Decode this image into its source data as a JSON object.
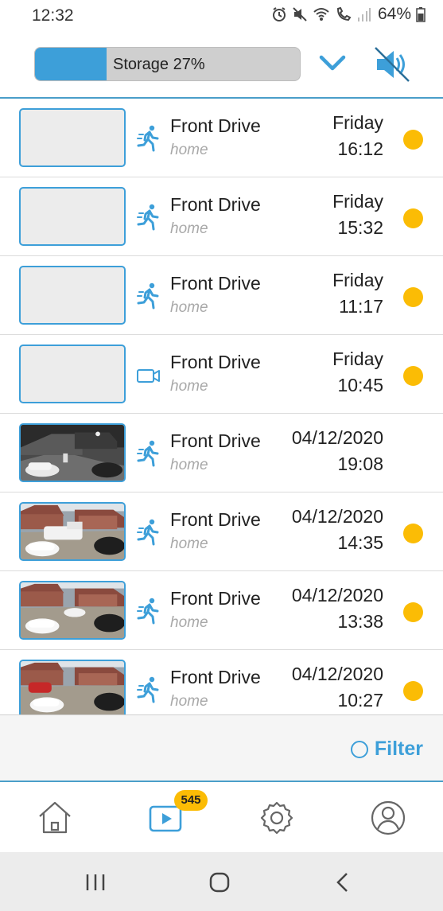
{
  "status_bar": {
    "time": "12:32",
    "battery": "64%"
  },
  "top_bar": {
    "storage_label": "Storage 27%",
    "storage_percent": 27
  },
  "events": [
    {
      "thumbnail": "blank",
      "type_icon": "motion-icon",
      "camera": "Front Drive",
      "location": "home",
      "day": "Friday",
      "time": "16:12",
      "unread": true
    },
    {
      "thumbnail": "blank",
      "type_icon": "motion-icon",
      "camera": "Front Drive",
      "location": "home",
      "day": "Friday",
      "time": "15:32",
      "unread": true
    },
    {
      "thumbnail": "blank",
      "type_icon": "motion-icon",
      "camera": "Front Drive",
      "location": "home",
      "day": "Friday",
      "time": "11:17",
      "unread": true
    },
    {
      "thumbnail": "blank",
      "type_icon": "video-camera-icon",
      "camera": "Front Drive",
      "location": "home",
      "day": "Friday",
      "time": "10:45",
      "unread": true
    },
    {
      "thumbnail": "night",
      "type_icon": "motion-icon",
      "camera": "Front Drive",
      "location": "home",
      "day": "04/12/2020",
      "time": "19:08",
      "unread": false
    },
    {
      "thumbnail": "day-van",
      "type_icon": "motion-icon",
      "camera": "Front Drive",
      "location": "home",
      "day": "04/12/2020",
      "time": "14:35",
      "unread": true
    },
    {
      "thumbnail": "day",
      "type_icon": "motion-icon",
      "camera": "Front Drive",
      "location": "home",
      "day": "04/12/2020",
      "time": "13:38",
      "unread": true
    },
    {
      "thumbnail": "day-red",
      "type_icon": "motion-icon",
      "camera": "Front Drive",
      "location": "home",
      "day": "04/12/2020",
      "time": "10:27",
      "unread": true
    }
  ],
  "filter": {
    "label": "Filter"
  },
  "bottom_nav": {
    "items": [
      "home-icon",
      "library-icon",
      "settings-icon",
      "account-icon"
    ],
    "badge": "545"
  },
  "colors": {
    "accent": "#3d9fd9",
    "unread_dot": "#fbbc05"
  }
}
